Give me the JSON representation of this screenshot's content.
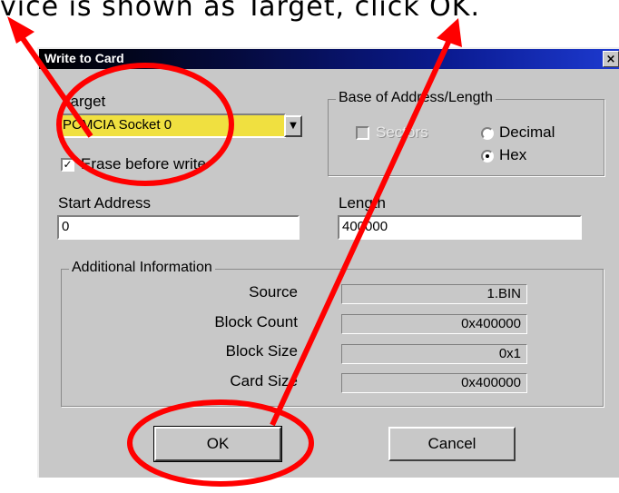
{
  "caption": "vice is shown as Target, click OK.",
  "dialog": {
    "title": "Write to Card",
    "close_label": "×",
    "target_label": "Target",
    "target_value": "PCMCIA Socket 0",
    "erase_label": "Erase before write",
    "erase_checked": true,
    "base_group_label": "Base of Address/Length",
    "sectors_label": "Sectors",
    "decimal_label": "Decimal",
    "hex_label": "Hex",
    "start_address_label": "Start Address",
    "start_address_value": "0",
    "length_label": "Length",
    "length_value": "400000",
    "additional_group_label": "Additional Information",
    "source_label": "Source",
    "source_value": "1.BIN",
    "block_count_label": "Block Count",
    "block_count_value": "0x400000",
    "block_size_label": "Block Size",
    "block_size_value": "0x1",
    "card_size_label": "Card Size",
    "card_size_value": "0x400000",
    "ok_label": "OK",
    "cancel_label": "Cancel"
  },
  "annotation_color": "#ff0000",
  "target_highlight_color": "#f0e040"
}
